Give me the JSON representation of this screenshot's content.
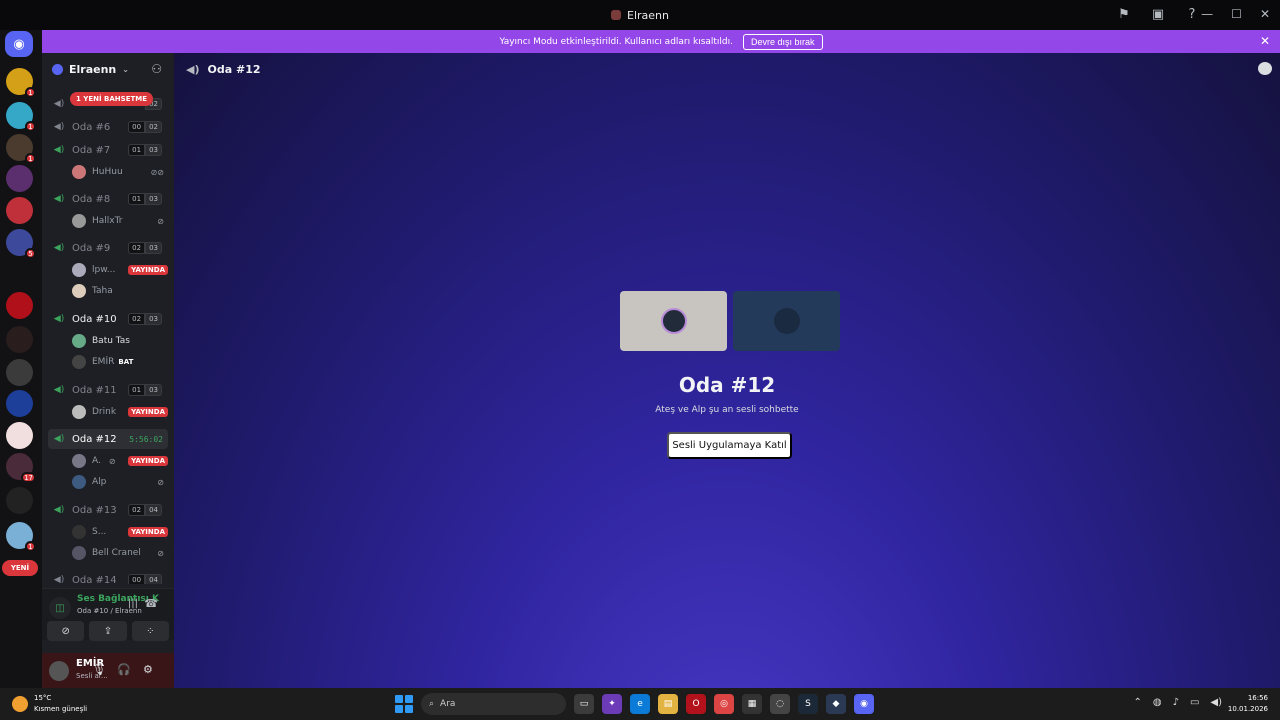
{
  "window": {
    "title": "Elraenn",
    "tools": [
      "flag-icon",
      "inbox-icon",
      "help-icon"
    ],
    "controls": {
      "minimize": "—",
      "maximize": "☐",
      "close": "✕"
    }
  },
  "banner": {
    "text": "Yayıncı Modu etkinleştirildi. Kullanıcı adları kısaltıldı.",
    "button": "Devre dışı bırak",
    "color": "#9447e8"
  },
  "guilds": {
    "badges": [
      "1",
      "1",
      "1",
      "5",
      "17",
      "1"
    ],
    "new_label": "YENİ"
  },
  "server": {
    "name": "Elraenn",
    "mention_pill": "1 YENİ BAHSETME"
  },
  "channels": [
    {
      "name": "",
      "counts": [
        "",
        "02"
      ]
    },
    {
      "name": "Oda #6",
      "counts": [
        "00",
        "02"
      ]
    },
    {
      "name": "Oda #7",
      "counts": [
        "01",
        "03"
      ],
      "users": [
        {
          "name": "HuHuu"
        }
      ]
    },
    {
      "name": "Oda #8",
      "counts": [
        "01",
        "03"
      ],
      "users": [
        {
          "name": "HallxTr"
        }
      ]
    },
    {
      "name": "Oda #9",
      "counts": [
        "02",
        "03"
      ],
      "users": [
        {
          "name": "lpw...",
          "live": "YAYINDA"
        },
        {
          "name": "Taha"
        }
      ]
    },
    {
      "name": "Oda #10",
      "counts": [
        "02",
        "03"
      ],
      "users": [
        {
          "name": "Batu Tas"
        },
        {
          "name": "EMİR",
          "tag": "BAT"
        }
      ]
    },
    {
      "name": "Oda #11",
      "counts": [
        "01",
        "03"
      ],
      "users": [
        {
          "name": "Drink",
          "live": "YAYINDA"
        }
      ]
    },
    {
      "name": "Oda #12",
      "timer": "5:56:02",
      "users": [
        {
          "name": "A.",
          "live": "YAYINDA"
        },
        {
          "name": "Alp"
        }
      ]
    },
    {
      "name": "Oda #13",
      "counts": [
        "02",
        "04"
      ],
      "users": [
        {
          "name": "S...",
          "live": "YAYINDA"
        },
        {
          "name": "Bell Cranel"
        }
      ]
    },
    {
      "name": "Oda #14",
      "counts": [
        "00",
        "04"
      ]
    }
  ],
  "voice": {
    "status": "Ses Bağlantısı K",
    "location": "Oda #10 / Elraenn"
  },
  "me": {
    "name": "EMİR",
    "status": "Sesli ar..."
  },
  "main": {
    "channel": "Oda #12",
    "title": "Oda #12",
    "subtitle": "Ateş ve Alp şu an sesli sohbette",
    "join_button": "Sesli Uygulamaya Katıl"
  },
  "taskbar": {
    "temp": "15°C",
    "weather": "Kısmen güneşli",
    "search_placeholder": "Ara",
    "time": "16:56",
    "date": "10.01.2026"
  },
  "colors": {
    "accent": "#5865f2",
    "live": "#da373c",
    "voice_green": "#3ba55d"
  }
}
